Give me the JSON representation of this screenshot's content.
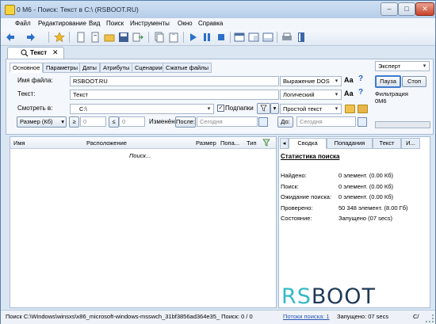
{
  "window": {
    "title": "0 М6 - Поиск: Текст в C:\\ (RSBOOT.RU)",
    "controls": {
      "minimize": "–",
      "maximize": "□",
      "close": "✕"
    }
  },
  "menu": [
    "Файл",
    "Редактирование",
    "Вид",
    "Поиск",
    "Инструменты",
    "Окно",
    "Справка"
  ],
  "toolbar": {
    "icons": [
      "back-arrow-icon",
      "forward-arrow-icon",
      "favorites-star-icon",
      "new-document-icon",
      "open-folder-icon",
      "save-icon",
      "export-icon",
      "copy-icon",
      "paste-icon",
      "play-icon",
      "pause-icon",
      "stop-icon",
      "layout-icon",
      "window-icon",
      "panel-icon",
      "print-icon",
      "book-icon"
    ]
  },
  "doc_tab": {
    "label": "Текст",
    "close": "✕"
  },
  "subtabs": [
    "Основное",
    "Параметры",
    "Даты",
    "Атрибуты",
    "Сценарии",
    "Сжатые файлы"
  ],
  "form": {
    "filename_label": "Имя файла:",
    "filename_value": "RSBOOT.RU",
    "filename_mode": "Выражение DOS",
    "text_label": "Текст:",
    "text_value": "Текст",
    "text_mode": "Логический",
    "lookin_label": "Смотреть в:",
    "lookin_value": "C:\\",
    "subfolders_label": "Подпапки",
    "subfolders_checked": "✓",
    "lookin_mode": "Простой текст",
    "aa_label": "Аа",
    "help_label": "?",
    "size_label": "Размер (Кб)",
    "size_min_op": "≥",
    "size_min": "0",
    "size_max_op": "≤",
    "size_max": "0",
    "changed_label": "Изменён:",
    "after_button": "После:",
    "after_placeholder": "Сегодня",
    "before_button": "До:",
    "before_placeholder": "Сегодня"
  },
  "right_panel": {
    "mode": "Эксперт",
    "pause": "Пауза",
    "stop": "Стоп",
    "filter_line1": "Фильтрация",
    "filter_line2": "0М6"
  },
  "results": {
    "columns": [
      "Имя",
      "Расположение",
      "Размер",
      "Попа...",
      "Тип"
    ],
    "status": "Поиск..."
  },
  "stats": {
    "tabs": [
      "◂",
      "Сводка",
      "Попадания",
      "Текст",
      "И..."
    ],
    "title": "Статистика поиска",
    "rows": [
      {
        "label": "Найдено:",
        "value": "0 элемент. (0.00 Кб)"
      },
      {
        "label": "Поиск:",
        "value": "0 элемент. (0.00 Кб)"
      },
      {
        "label": "Ожидание поиска:",
        "value": "0 элемент. (0.00 Кб)"
      },
      {
        "label": "Проверено:",
        "value": "50 348 элемент. (8.00 Гб)"
      },
      {
        "label": "Состояние:",
        "value": "Запущено (07 secs)"
      }
    ],
    "logo_part1": "RS",
    "logo_part2": "BOOT"
  },
  "statusbar": {
    "path": "Поиск C:\\Windows\\winsxs\\x86_microsoft-windows-msswch_31bf3856ad364e35_ Поиск: 0 / 0",
    "threads": "Потоки поиска: 1",
    "state": "Запущено: 07 secs",
    "extra": "C/"
  },
  "colors": {
    "accent": "#3d7bd0",
    "logo_cyan": "#34b9c6",
    "logo_dark": "#1f3a57"
  }
}
